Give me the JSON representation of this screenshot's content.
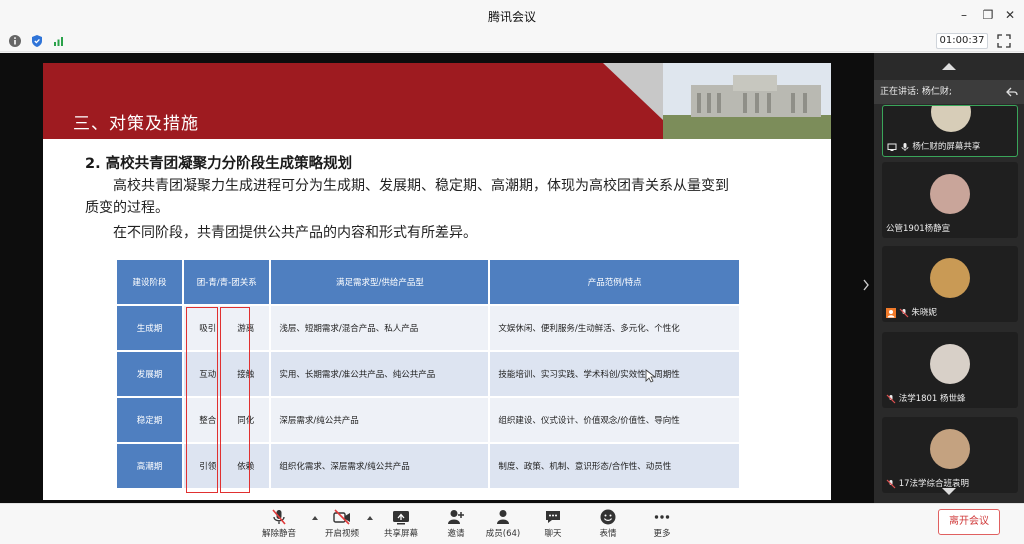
{
  "window": {
    "title": "腾讯会议"
  },
  "status": {
    "timer": "01:00:37"
  },
  "slide": {
    "section_title": "三、对策及措施",
    "heading": "2. 高校共青团凝聚力分阶段生成策略规划",
    "para1_line1": "高校共青团凝聚力生成进程可分为生成期、发展期、稳定期、高潮期，体现为高校团青关系从量变到",
    "para1_line2": "质变的过程。",
    "para2": "在不同阶段，共青团提供公共产品的内容和形式有所差异。",
    "table": {
      "headers": [
        "建设阶段",
        "团-青/青-团关系",
        "满足需求型/供给产品型",
        "产品范例/特点"
      ],
      "rows": [
        {
          "stage": "生成期",
          "rel_a": "吸引",
          "rel_b": "游离",
          "demand": "浅层、短期需求/混合产品、私人产品",
          "example": "文娱休闲、便利服务/生动鲜活、多元化、个性化"
        },
        {
          "stage": "发展期",
          "rel_a": "互动",
          "rel_b": "接触",
          "demand": "实用、长期需求/准公共产品、纯公共产品",
          "example": "技能培训、实习实践、学术科创/实效性、周期性"
        },
        {
          "stage": "稳定期",
          "rel_a": "整合",
          "rel_b": "同化",
          "demand": "深层需求/纯公共产品",
          "example": "组织建设、仪式设计、价值观念/价值性、导向性"
        },
        {
          "stage": "高潮期",
          "rel_a": "引领",
          "rel_b": "依赖",
          "demand": "组织化需求、深层需求/纯公共产品",
          "example": "制度、政策、机制、意识形态/合作性、动员性"
        }
      ]
    }
  },
  "sidebar": {
    "speaking": "正在讲话: 杨仁财;",
    "participants": [
      {
        "name": "杨仁财的屏幕共享"
      },
      {
        "name": "公管1901杨静宣"
      },
      {
        "name": "朱晓妮"
      },
      {
        "name": "法学1801 杨世蜂"
      },
      {
        "name": "17法学综合班袁明"
      }
    ]
  },
  "toolbar": {
    "unmute": "解除静音",
    "video": "开启视频",
    "share": "共享屏幕",
    "invite": "邀请",
    "members": "成员(64)",
    "chat": "聊天",
    "emoji": "表情",
    "more": "更多",
    "leave": "离开会议"
  },
  "colors": {
    "banner_red": "#9e1b20",
    "table_blue": "#4f7fc0",
    "leave_red": "#d03a3a"
  }
}
